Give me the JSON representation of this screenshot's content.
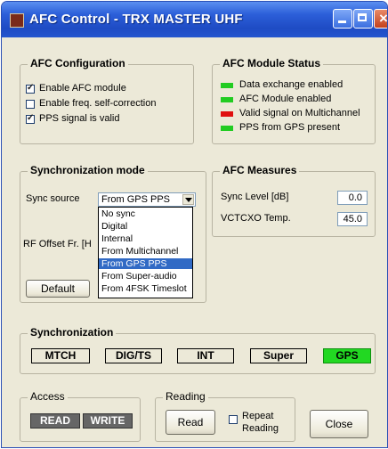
{
  "window": {
    "title": "AFC Control - TRX MASTER UHF"
  },
  "afc_config": {
    "title": "AFC Configuration",
    "items": [
      {
        "label": "Enable AFC module",
        "checked": true
      },
      {
        "label": "Enable freq. self-correction",
        "checked": false
      },
      {
        "label": "PPS signal is valid",
        "checked": true
      }
    ]
  },
  "afc_status": {
    "title": "AFC Module Status",
    "items": [
      {
        "label": "Data exchange enabled",
        "color": "#22cc22"
      },
      {
        "label": "AFC Module enabled",
        "color": "#22cc22"
      },
      {
        "label": "Valid signal on Multichannel",
        "color": "#e01010"
      },
      {
        "label": "PPS from GPS present",
        "color": "#22cc22"
      }
    ]
  },
  "sync_mode": {
    "title": "Synchronization mode",
    "source_label": "Sync source",
    "selected": "From GPS PPS",
    "options": [
      "No sync",
      "Digital",
      "Internal",
      "From Multichannel",
      "From GPS PPS",
      "From Super-audio",
      "From 4FSK Timeslot"
    ],
    "rf_offset_label": "RF Offset Fr. [H",
    "default_button": "Default"
  },
  "afc_measures": {
    "title": "AFC Measures",
    "sync_level_label": "Sync Level [dB]",
    "sync_level_value": "0.0",
    "vctcxo_label": "VCTCXO Temp.",
    "vctcxo_value": "45.0"
  },
  "synchronization": {
    "title": "Synchronization",
    "indicators": [
      {
        "label": "MTCH",
        "active": false
      },
      {
        "label": "DIG/TS",
        "active": false
      },
      {
        "label": "INT",
        "active": false
      },
      {
        "label": "Super",
        "active": false
      },
      {
        "label": "GPS",
        "active": true
      }
    ]
  },
  "access": {
    "title": "Access",
    "read": "READ",
    "write": "WRITE"
  },
  "reading": {
    "title": "Reading",
    "read_button": "Read",
    "repeat_label_1": "Repeat",
    "repeat_label_2": "Reading",
    "repeat_checked": false
  },
  "close_button": "Close"
}
